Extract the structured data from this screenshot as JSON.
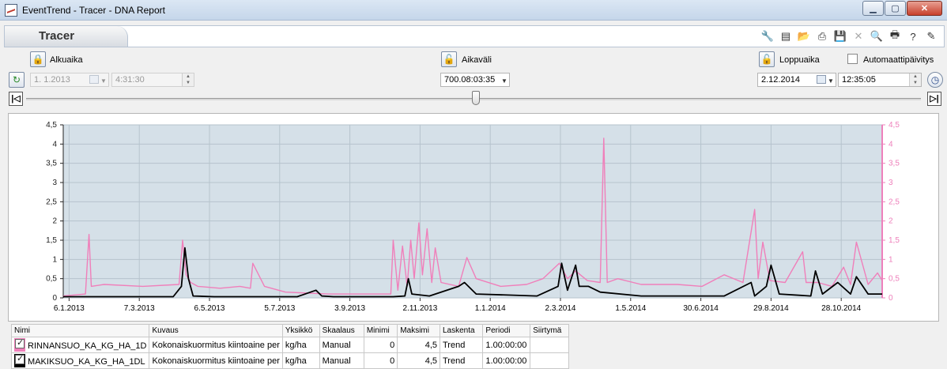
{
  "window": {
    "title": "EventTrend - Tracer - DNA Report"
  },
  "header": {
    "title": "Tracer"
  },
  "toolbar": {
    "icons": [
      "wrench-icon",
      "new-document-icon",
      "open-folder-icon",
      "print-setup-icon",
      "save-icon",
      "delete-icon",
      "zoom-icon",
      "print-icon",
      "help-icon",
      "edit-icon"
    ]
  },
  "controls": {
    "start": {
      "label": "Alkuaika",
      "date": "1.  1.2013",
      "time": "4:31:30"
    },
    "interval": {
      "label": "Aikaväli",
      "value": "700.08:03:35"
    },
    "end": {
      "label": "Loppuaika",
      "date": "2.12.2014",
      "time": "12:35:05"
    },
    "auto_update_label": "Automaattipäivitys"
  },
  "chart_data": {
    "type": "line",
    "ylim": [
      0,
      4.5
    ],
    "y_ticks": [
      "0",
      "0,5",
      "1",
      "1,5",
      "2",
      "2,5",
      "3",
      "3,5",
      "4",
      "4,5"
    ],
    "x_ticks": [
      "6.1.2013",
      "7.3.2013",
      "6.5.2013",
      "5.7.2013",
      "3.9.2013",
      "2.11.2013",
      "1.1.2014",
      "2.3.2014",
      "1.5.2014",
      "30.6.2014",
      "29.8.2014",
      "28.10.2014"
    ],
    "colors": {
      "left_axis": "#222222",
      "right_axis": "#ee80bb",
      "background": "#d5e0e8"
    },
    "series": [
      {
        "name": "RINNANSUO_KA_KG_HA_1D",
        "color": "#f07fba",
        "x": [
          "2013-01-01",
          "2013-01-20",
          "2013-01-23",
          "2013-01-25",
          "2013-02-05",
          "2013-03-10",
          "2013-04-10",
          "2013-04-13",
          "2013-04-16",
          "2013-04-20",
          "2013-04-26",
          "2013-05-15",
          "2013-06-01",
          "2013-06-10",
          "2013-06-12",
          "2013-06-22",
          "2013-07-10",
          "2013-08-15",
          "2013-09-20",
          "2013-10-08",
          "2013-10-10",
          "2013-10-14",
          "2013-10-18",
          "2013-10-22",
          "2013-10-25",
          "2013-10-28",
          "2013-11-01",
          "2013-11-04",
          "2013-11-08",
          "2013-11-12",
          "2013-11-15",
          "2013-11-20",
          "2013-12-05",
          "2013-12-12",
          "2013-12-20",
          "2014-01-10",
          "2014-02-01",
          "2014-02-15",
          "2014-03-01",
          "2014-03-08",
          "2014-03-15",
          "2014-03-25",
          "2014-04-05",
          "2014-04-08",
          "2014-04-11",
          "2014-04-20",
          "2014-05-10",
          "2014-06-10",
          "2014-07-01",
          "2014-07-20",
          "2014-08-05",
          "2014-08-15",
          "2014-08-18",
          "2014-08-22",
          "2014-08-28",
          "2014-09-10",
          "2014-09-25",
          "2014-09-28",
          "2014-10-08",
          "2014-10-20",
          "2014-10-30",
          "2014-11-05",
          "2014-11-10",
          "2014-11-20",
          "2014-11-28",
          "2014-12-02"
        ],
        "values": [
          0.05,
          0.1,
          1.65,
          0.3,
          0.35,
          0.3,
          0.35,
          1.5,
          0.6,
          0.4,
          0.3,
          0.25,
          0.3,
          0.25,
          0.9,
          0.3,
          0.15,
          0.1,
          0.1,
          0.1,
          1.5,
          0.2,
          1.35,
          0.3,
          1.5,
          0.5,
          1.95,
          0.6,
          1.8,
          0.4,
          1.3,
          0.4,
          0.3,
          1.05,
          0.5,
          0.3,
          0.35,
          0.5,
          0.9,
          0.5,
          0.7,
          0.45,
          0.4,
          4.15,
          0.4,
          0.5,
          0.35,
          0.35,
          0.3,
          0.6,
          0.4,
          2.3,
          0.5,
          1.45,
          0.45,
          0.4,
          1.2,
          0.4,
          0.4,
          0.3,
          0.8,
          0.35,
          1.45,
          0.35,
          0.65,
          0.45
        ]
      },
      {
        "name": "MAKIKSUO_KA_KG_HA_1DL",
        "color": "#000000",
        "x": [
          "2013-01-01",
          "2013-04-05",
          "2013-04-12",
          "2013-04-15",
          "2013-04-18",
          "2013-04-22",
          "2013-05-10",
          "2013-07-20",
          "2013-08-05",
          "2013-08-10",
          "2013-08-20",
          "2013-10-10",
          "2013-10-20",
          "2013-10-23",
          "2013-10-26",
          "2013-11-10",
          "2013-12-05",
          "2013-12-10",
          "2013-12-20",
          "2014-02-10",
          "2014-02-28",
          "2014-03-03",
          "2014-03-08",
          "2014-03-15",
          "2014-03-18",
          "2014-03-26",
          "2014-04-05",
          "2014-05-10",
          "2014-06-15",
          "2014-07-20",
          "2014-08-12",
          "2014-08-15",
          "2014-08-25",
          "2014-08-29",
          "2014-09-05",
          "2014-10-02",
          "2014-10-06",
          "2014-10-12",
          "2014-10-25",
          "2014-11-05",
          "2014-11-10",
          "2014-11-20",
          "2014-12-02"
        ],
        "values": [
          0.03,
          0.03,
          0.3,
          1.3,
          0.5,
          0.05,
          0.03,
          0.03,
          0.2,
          0.05,
          0.03,
          0.03,
          0.05,
          0.5,
          0.1,
          0.05,
          0.3,
          0.4,
          0.1,
          0.05,
          0.3,
          0.9,
          0.2,
          0.85,
          0.3,
          0.3,
          0.15,
          0.05,
          0.05,
          0.05,
          0.4,
          0.05,
          0.3,
          0.85,
          0.1,
          0.05,
          0.7,
          0.1,
          0.4,
          0.1,
          0.55,
          0.1,
          0.1
        ]
      }
    ]
  },
  "legend_table": {
    "headers": [
      "Nimi",
      "Kuvaus",
      "Yksikkö",
      "Skaalaus",
      "Minimi",
      "Maksimi",
      "Laskenta",
      "Periodi",
      "Siirtymä"
    ],
    "rows": [
      {
        "name": "RINNANSUO_KA_KG_HA_1D",
        "desc": "Kokonaiskuormitus kiintoaine per",
        "unit": "kg/ha",
        "scale": "Manual",
        "min": "0",
        "max": "4,5",
        "calc": "Trend",
        "period": "1.00:00:00",
        "shift": "",
        "color": "#f07fba"
      },
      {
        "name": "MAKIKSUO_KA_KG_HA_1DL",
        "desc": "Kokonaiskuormitus kiintoaine per",
        "unit": "kg/ha",
        "scale": "Manual",
        "min": "0",
        "max": "4,5",
        "calc": "Trend",
        "period": "1.00:00:00",
        "shift": "",
        "color": "#000000"
      }
    ]
  }
}
